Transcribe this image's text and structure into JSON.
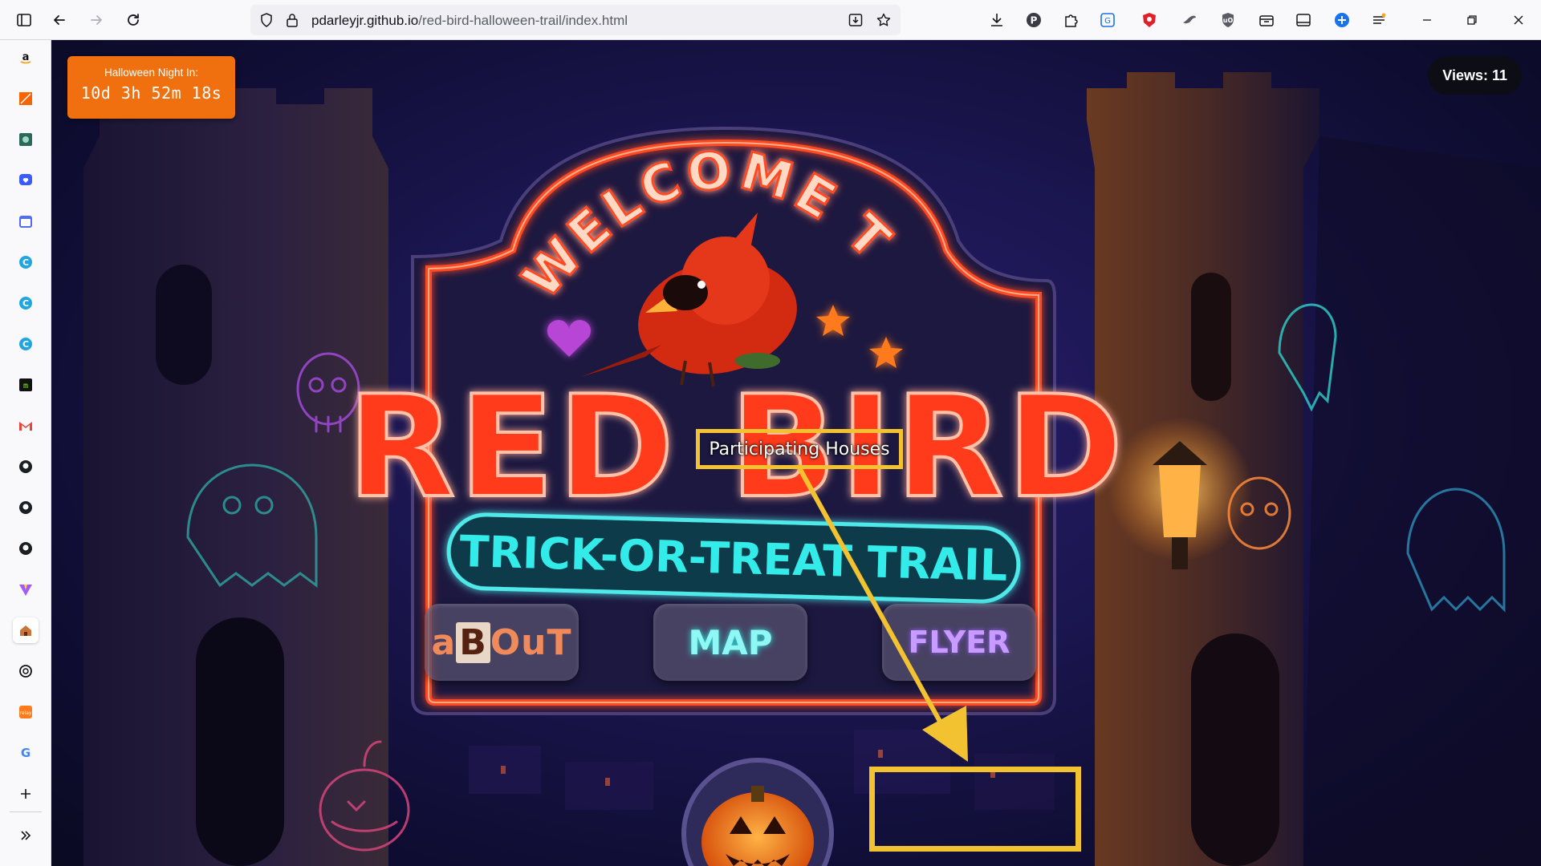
{
  "browser": {
    "url_host": "pdarleyjr.github.io",
    "url_path": "/red-bird-halloween-trail/index.html",
    "icons": {
      "sidebar_toggle": "sidebar-icon",
      "back": "back-arrow-icon",
      "forward": "forward-arrow-icon",
      "reload": "reload-icon",
      "tracking": "shield-icon",
      "lock": "lock-icon",
      "save_page": "save-to-pocket-icon",
      "bookmark": "star-icon"
    },
    "extensions": [
      "download-icon",
      "p-extension-icon",
      "puzzle-extension-icon",
      "translate-icon",
      "brave-shield-icon",
      "bird-extension-icon",
      "ublock-icon",
      "container-icon",
      "reader-icon",
      "globe-extension-icon",
      "menu-icon"
    ],
    "window_controls": [
      "minimize-icon",
      "restore-icon",
      "close-icon"
    ]
  },
  "sidebar": {
    "items": [
      "amazon-icon",
      "home-depot-icon",
      "photo-app-icon",
      "heart-chat-icon",
      "calendar-icon",
      "copilot-icon",
      "copilot-icon",
      "copilot-icon",
      "terminal-icon",
      "gmail-icon",
      "github-icon",
      "github-icon",
      "github-icon",
      "vite-icon",
      "house-tab-icon",
      "openai-icon",
      "firefox-relay-icon",
      "google-icon"
    ],
    "add": "plus-icon",
    "expand": "double-chevron-icon"
  },
  "page": {
    "countdown_label": "Halloween Night In:",
    "countdown_value": "10d 3h 52m 18s",
    "views": "Views: 11",
    "sign_welcome": "WELCOME TO",
    "sign_title": "RED BIRD",
    "sign_subtitle": "TRICK-OR-TREAT TRAIL",
    "buttons": {
      "about_parts": [
        "a",
        "B",
        "O",
        "u",
        "T"
      ],
      "map": "MAP",
      "flyer": "FLYER"
    },
    "tooltip": "Participating Houses",
    "accent": "#f2c230",
    "neon_red": "#ff3b1f",
    "neon_teal": "#2ee7e0"
  }
}
